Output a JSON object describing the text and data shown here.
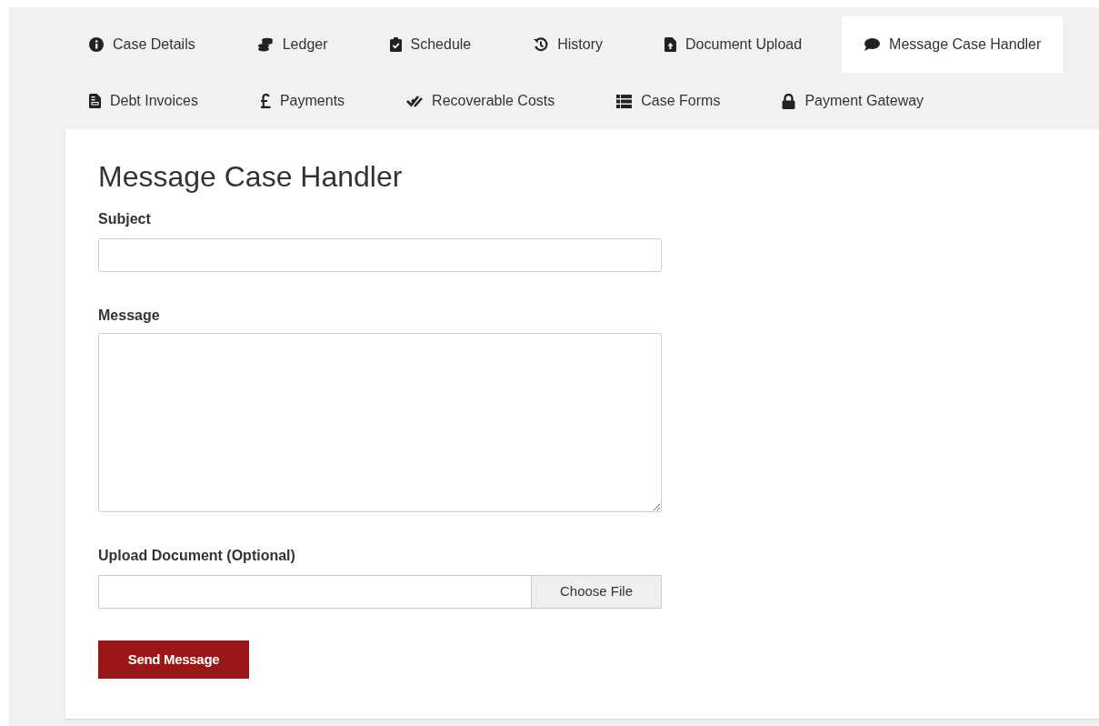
{
  "tabs": [
    {
      "label": "Case Details",
      "selected": false
    },
    {
      "label": "Ledger",
      "selected": false
    },
    {
      "label": "Schedule",
      "selected": false
    },
    {
      "label": "History",
      "selected": false
    },
    {
      "label": "Document Upload",
      "selected": false
    },
    {
      "label": "Message Case Handler",
      "selected": true
    },
    {
      "label": "Debt Invoices",
      "selected": false
    },
    {
      "label": "Payments",
      "selected": false
    },
    {
      "label": "Recoverable Costs",
      "selected": false
    },
    {
      "label": "Case Forms",
      "selected": false
    },
    {
      "label": "Payment Gateway",
      "selected": false
    }
  ],
  "form": {
    "title": "Message Case Handler",
    "subject": {
      "label": "Subject"
    },
    "message": {
      "label": "Message"
    },
    "upload": {
      "label": "Upload Document (Optional)",
      "button": "Choose File"
    },
    "submit": "Send Message"
  }
}
